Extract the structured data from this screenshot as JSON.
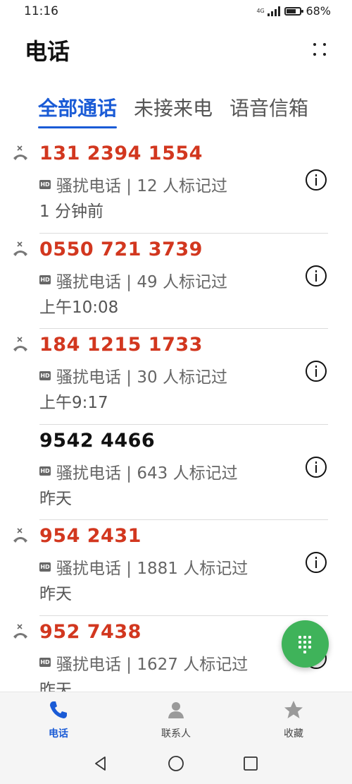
{
  "status_bar": {
    "time": "11:16",
    "network": "4G",
    "battery": "68%",
    "icons": [
      "signal-icon",
      "battery-icon"
    ]
  },
  "header": {
    "title": "电话",
    "more_icon": "more-dots-icon"
  },
  "tabs": [
    {
      "label": "全部通话",
      "active": true
    },
    {
      "label": "未接来电",
      "active": false
    },
    {
      "label": "语音信箱",
      "active": false
    }
  ],
  "calls": [
    {
      "number": "131 2394 1554",
      "missed": true,
      "badge": "HD",
      "tag": "骚扰电话 | 12 人标记过",
      "time": "1 分钟前"
    },
    {
      "number": "0550 721 3739",
      "missed": true,
      "badge": "HD",
      "tag": "骚扰电话 | 49 人标记过",
      "time": "上午10:08"
    },
    {
      "number": "184 1215 1733",
      "missed": true,
      "badge": "HD",
      "tag": "骚扰电话 | 30 人标记过",
      "time": "上午9:17"
    },
    {
      "number": "9542 4466",
      "missed": false,
      "badge": "HD",
      "tag": "骚扰电话 | 643 人标记过",
      "time": "昨天"
    },
    {
      "number": "954 2431",
      "missed": true,
      "badge": "HD",
      "tag": "骚扰电话 | 1881 人标记过",
      "time": "昨天"
    },
    {
      "number": "952 7438",
      "missed": true,
      "badge": "HD",
      "tag": "骚扰电话 | 1627 人标记过",
      "time": "昨天"
    }
  ],
  "fab": {
    "icon": "dialpad-icon"
  },
  "bottom_nav": [
    {
      "label": "电话",
      "icon": "phone-icon",
      "active": true
    },
    {
      "label": "联系人",
      "icon": "contacts-icon",
      "active": false
    },
    {
      "label": "收藏",
      "icon": "star-icon",
      "active": false
    }
  ],
  "system_nav": [
    "back-icon",
    "home-icon",
    "recents-icon"
  ],
  "colors": {
    "accent": "#1a5bd6",
    "missed": "#d2371f",
    "fab": "#3fb35a"
  }
}
